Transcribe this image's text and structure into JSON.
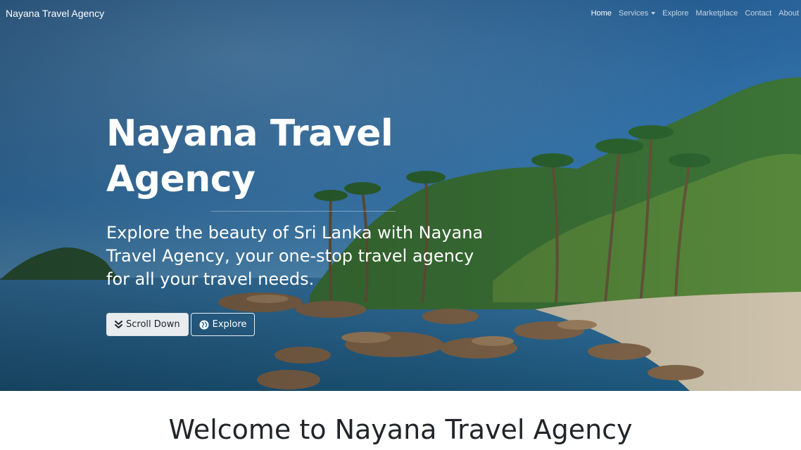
{
  "navbar": {
    "brand": "Nayana Travel Agency",
    "links": [
      {
        "label": "Home",
        "active": true
      },
      {
        "label": "Services",
        "dropdown": true
      },
      {
        "label": "Explore"
      },
      {
        "label": "Marketplace"
      },
      {
        "label": "Contact"
      },
      {
        "label": "About"
      }
    ]
  },
  "hero": {
    "title_line1": "Nayana Travel",
    "title_line2": "Agency",
    "lead": "Explore the beauty of Sri Lanka with Nayana Travel Agency, your one-stop travel agency for all your travel needs.",
    "buttons": {
      "scroll_down": {
        "label": "Scroll Down",
        "icon": "double-chevron-down-icon"
      },
      "explore": {
        "label": "Explore",
        "icon": "globe-icon"
      }
    },
    "background": "tropical-beach-photo"
  },
  "welcome": {
    "title": "Welcome to Nayana Travel Agency"
  },
  "colors": {
    "nav_text": "#ffffff",
    "hero_text": "#ffffff",
    "button_light": "#e9ecef",
    "heading_dark": "#212529"
  }
}
